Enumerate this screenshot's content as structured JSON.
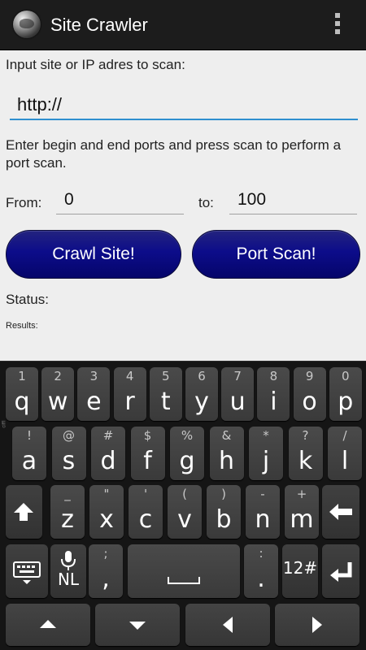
{
  "app": {
    "title": "Site Crawler"
  },
  "form": {
    "url_label": "Input site or IP adres to scan:",
    "url_value": "http://",
    "instructions": "Enter begin and end ports and press scan to perform a port scan.",
    "from_label": "From:",
    "from_value": "0",
    "to_label": "to:",
    "to_value": "100",
    "crawl_button": "Crawl Site!",
    "scan_button": "Port Scan!",
    "status_label": "Status:",
    "results_label": "Results:"
  },
  "keyboard": {
    "row1": [
      {
        "alt": "1",
        "main": "q"
      },
      {
        "alt": "2",
        "main": "w"
      },
      {
        "alt": "3",
        "main": "e"
      },
      {
        "alt": "4",
        "main": "r"
      },
      {
        "alt": "5",
        "main": "t"
      },
      {
        "alt": "6",
        "main": "y"
      },
      {
        "alt": "7",
        "main": "u"
      },
      {
        "alt": "8",
        "main": "i"
      },
      {
        "alt": "9",
        "main": "o"
      },
      {
        "alt": "0",
        "main": "p"
      }
    ],
    "row2": [
      {
        "alt": "!",
        "main": "a"
      },
      {
        "alt": "@",
        "main": "s"
      },
      {
        "alt": "#",
        "main": "d"
      },
      {
        "alt": "$",
        "main": "f"
      },
      {
        "alt": "%",
        "main": "g"
      },
      {
        "alt": "&",
        "main": "h"
      },
      {
        "alt": "*",
        "main": "j"
      },
      {
        "alt": "?",
        "main": "k"
      },
      {
        "alt": "/",
        "main": "l"
      }
    ],
    "row3": [
      {
        "alt": "_",
        "main": "z"
      },
      {
        "alt": "\"",
        "main": "x"
      },
      {
        "alt": "'",
        "main": "c"
      },
      {
        "alt": "(",
        "main": "v"
      },
      {
        "alt": ")",
        "main": "b"
      },
      {
        "alt": "-",
        "main": "n"
      },
      {
        "alt": "+",
        "main": "m"
      }
    ],
    "language": "NL",
    "comma_alt": ";",
    "comma": ",",
    "period_alt": ":",
    "period": ".",
    "symbols": "12#",
    "side_label": "ciffI"
  },
  "icons": {
    "shift": "shift-icon",
    "backspace": "backspace-icon",
    "keyboard_settings": "keyboard-icon",
    "mic": "microphone-icon",
    "space": "space-icon",
    "enter": "enter-icon"
  },
  "colors": {
    "accent": "#2f8fcf",
    "button": "#0c0c8a",
    "actionbar": "#1c1c1c"
  }
}
